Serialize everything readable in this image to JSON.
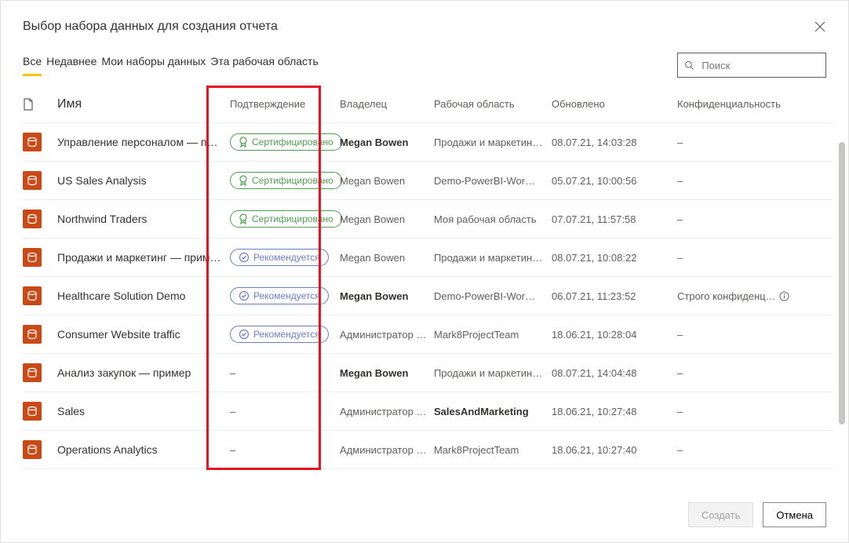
{
  "dialog": {
    "title": "Выбор набора данных для создания отчета"
  },
  "tabs": {
    "items": [
      "Все",
      "Недавнее",
      "Мои наборы данных",
      "Эта рабочая область"
    ],
    "active_index": 0
  },
  "search": {
    "placeholder": "Поиск"
  },
  "columns": {
    "name": "Имя",
    "endorsement": "Подтверждение",
    "owner": "Владелец",
    "workspace": "Рабочая область",
    "updated": "Обновлено",
    "sensitivity": "Конфиденциальность"
  },
  "endorsement_labels": {
    "cert": "Сертифицировано",
    "prom": "Рекомендуется"
  },
  "rows": [
    {
      "name": "Управление персоналом — пример",
      "endorsement": "cert",
      "owner": "Megan Bowen",
      "owner_bold": true,
      "workspace": "Продажи и маркетинг …",
      "ws_bold": false,
      "updated": "08.07.21, 14:03:28",
      "sensitivity": "–"
    },
    {
      "name": "US Sales Analysis",
      "endorsement": "cert",
      "owner": "Megan Bowen",
      "owner_bold": false,
      "workspace": "Demo-PowerBI-Wor…",
      "ws_bold": false,
      "updated": "05.07.21, 10:00:56",
      "sensitivity": "–"
    },
    {
      "name": "Northwind Traders",
      "endorsement": "cert",
      "owner": "Megan Bowen",
      "owner_bold": false,
      "workspace": "Моя рабочая область",
      "ws_bold": false,
      "updated": "07.07.21, 11:57:58",
      "sensitivity": "–"
    },
    {
      "name": "Продажи и маркетинг — пример…",
      "endorsement": "prom",
      "owner": "Megan Bowen",
      "owner_bold": false,
      "workspace": "Продажи и маркетинг …",
      "ws_bold": false,
      "updated": "08.07.21, 10:08:22",
      "sensitivity": "–"
    },
    {
      "name": "Healthcare Solution Demo",
      "endorsement": "prom",
      "owner": "Megan Bowen",
      "owner_bold": true,
      "workspace": "Demo-PowerBI-Wor…",
      "ws_bold": false,
      "updated": "06.07.21, 11:23:52",
      "sensitivity": "Строго конфиденц…",
      "sens_info": true
    },
    {
      "name": "Consumer Website traffic",
      "endorsement": "prom",
      "owner": "Администратор MOD",
      "owner_bold": false,
      "workspace": "Mark8ProjectTeam",
      "ws_bold": false,
      "updated": "18.06.21, 10:28:04",
      "sensitivity": "–"
    },
    {
      "name": "Анализ закупок — пример",
      "endorsement": "none",
      "owner": "Megan Bowen",
      "owner_bold": true,
      "workspace": "Продажи и маркетинг …",
      "ws_bold": false,
      "updated": "08.07.21, 14:04:48",
      "sensitivity": "–"
    },
    {
      "name": "Sales",
      "endorsement": "none",
      "owner": "Администратор MO",
      "owner_bold": false,
      "workspace": "SalesAndMarketing",
      "ws_bold": true,
      "updated": "18.06.21, 10:27:48",
      "sensitivity": "–"
    },
    {
      "name": "Operations Analytics",
      "endorsement": "none",
      "owner": "Администратор MOD",
      "owner_bold": false,
      "workspace": "Mark8ProjectTeam",
      "ws_bold": false,
      "updated": "18.06.21, 10:27:40",
      "sensitivity": "–"
    }
  ],
  "footer": {
    "create": "Создать",
    "cancel": "Отмена"
  },
  "none_dash": "–"
}
